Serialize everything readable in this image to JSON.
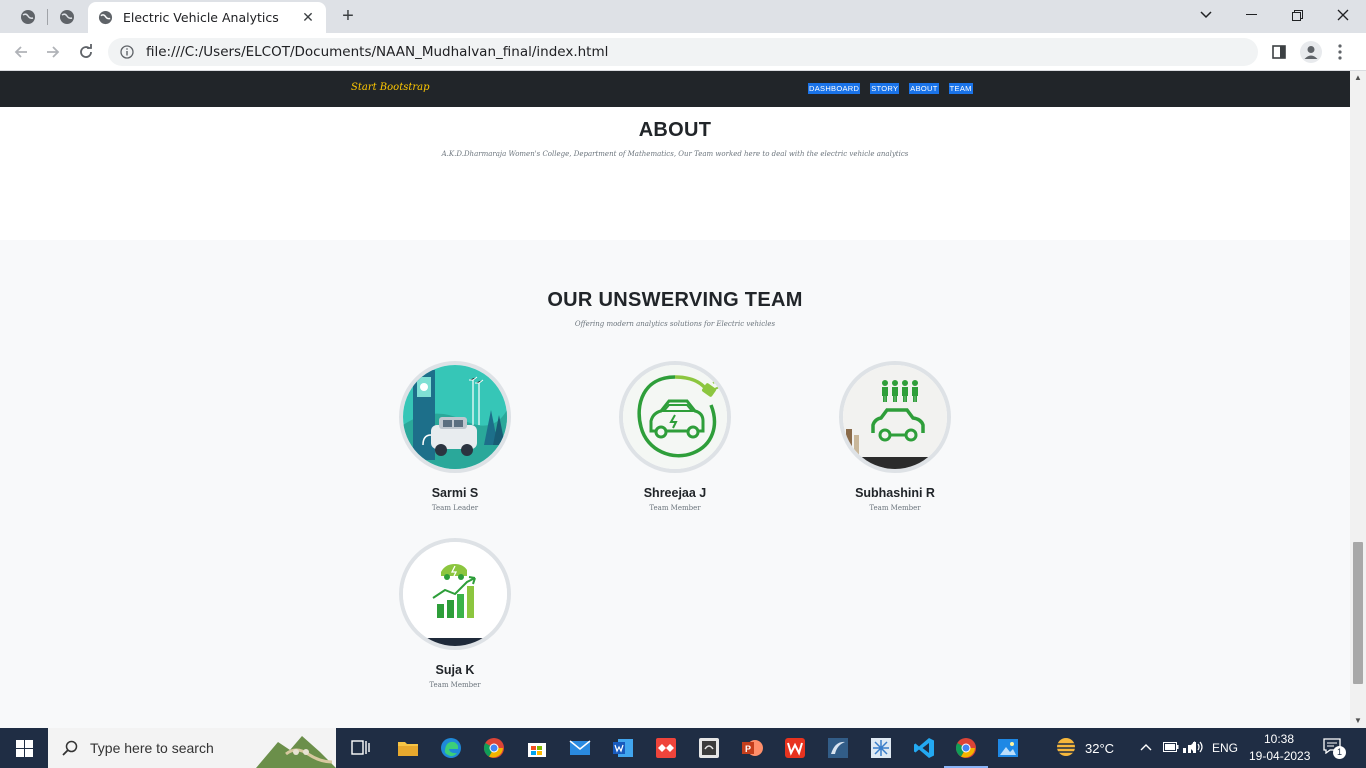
{
  "browser": {
    "tab_title": "Electric Vehicle Analytics",
    "url": "file:///C:/Users/ELCOT/Documents/NAAN_Mudhalvan_final/index.html"
  },
  "site": {
    "brand": "Start Bootstrap",
    "nav": [
      "DASHBOARD",
      "STORY",
      "ABOUT",
      "TEAM"
    ]
  },
  "about": {
    "heading": "ABOUT",
    "subheading": "A.K.D.Dharmaraja Women's College, Department of Mathematics, Our Team worked here to deal with the electric vehicle analytics"
  },
  "team": {
    "heading": "OUR UNSWERVING TEAM",
    "subheading": "Offering modern analytics solutions for Electric vehicles",
    "members": [
      {
        "name": "Sarmi S",
        "role": "Team Leader"
      },
      {
        "name": "Shreejaa J",
        "role": "Team Member"
      },
      {
        "name": "Subhashini R",
        "role": "Team Member"
      },
      {
        "name": "Suja K",
        "role": "Team Member"
      }
    ]
  },
  "taskbar": {
    "search_placeholder": "Type here to search",
    "temperature": "32°C",
    "language": "ENG",
    "time": "10:38",
    "date": "19-04-2023",
    "notification_count": "1"
  },
  "colors": {
    "nav_bg": "#212529",
    "brand": "#ffc800",
    "link_highlight": "#1a73e8",
    "team_bg": "#f8f9fa"
  }
}
